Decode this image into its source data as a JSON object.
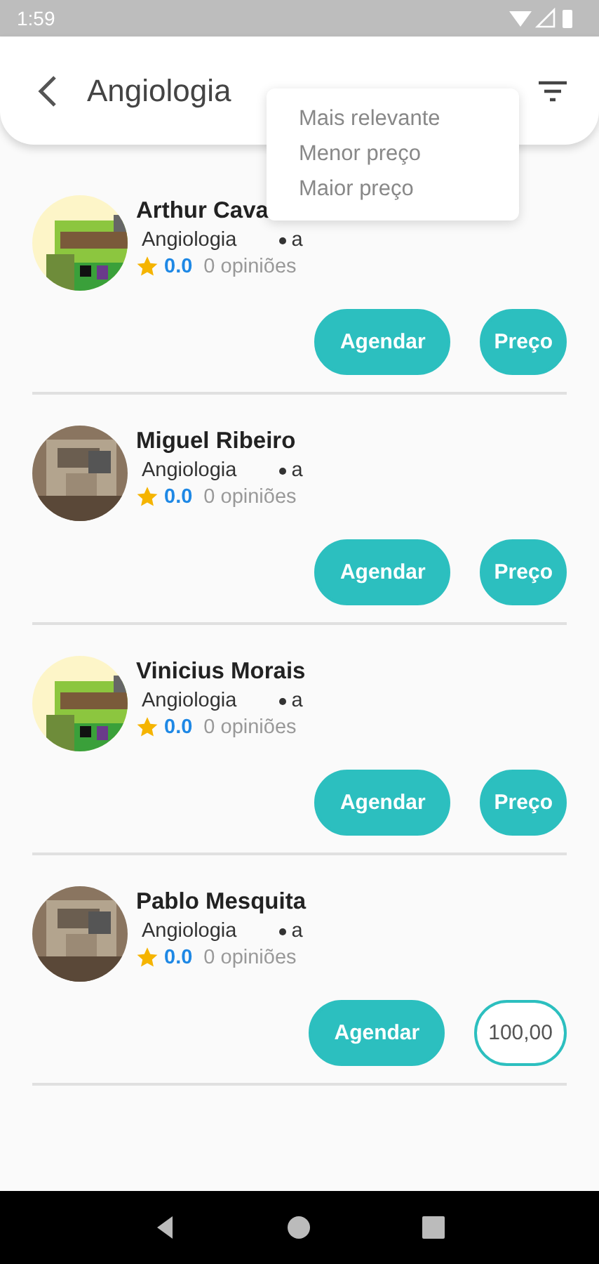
{
  "status_bar": {
    "time": "1:59"
  },
  "header": {
    "title": "Angiologia"
  },
  "sort_menu": {
    "items": [
      "Mais relevante",
      "Menor preço",
      "Maior preço"
    ]
  },
  "doctors": [
    {
      "name": "Arthur Cava",
      "specialty": "Angiologia",
      "extra": "a",
      "rating": "0.0",
      "reviews": "0 opiniões",
      "schedule_label": "Agendar",
      "price": {
        "kind": "label",
        "text": "Preço"
      }
    },
    {
      "name": "Miguel Ribeiro",
      "specialty": "Angiologia",
      "extra": "a",
      "rating": "0.0",
      "reviews": "0 opiniões",
      "schedule_label": "Agendar",
      "price": {
        "kind": "label",
        "text": "Preço"
      }
    },
    {
      "name": "Vinicius Morais",
      "specialty": "Angiologia",
      "extra": "a",
      "rating": "0.0",
      "reviews": "0 opiniões",
      "schedule_label": "Agendar",
      "price": {
        "kind": "label",
        "text": "Preço"
      }
    },
    {
      "name": "Pablo Mesquita",
      "specialty": "Angiologia",
      "extra": "a",
      "rating": "0.0",
      "reviews": "0 opiniões",
      "schedule_label": "Agendar",
      "price": {
        "kind": "value",
        "text": "100,00"
      }
    }
  ]
}
